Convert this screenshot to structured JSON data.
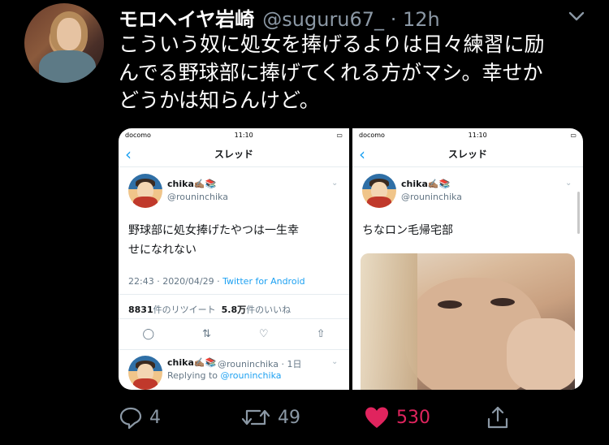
{
  "tweet": {
    "author_name": "モロヘイヤ岩崎",
    "author_meta": "@suguru67_ · 12h",
    "text_lines": [
      "こういう奴に処女を捧げるよりは日々練習に励",
      "んでる野球部に捧げてくれる方がマシ。幸せか",
      "どうかは知らんけど。"
    ],
    "actions": {
      "reply_count": "4",
      "retweet_count": "49",
      "like_count": "530"
    }
  },
  "media_left": {
    "carrier": "docomo",
    "time": "11:10",
    "nav_title": "スレッド",
    "main": {
      "name": "chika✍🏽📚",
      "handle": "@rouninchika",
      "body_lines": [
        "野球部に処女捧げたやつは一生幸",
        "せになれない"
      ],
      "timestamp": "22:43 · 2020/04/29 · ",
      "client": "Twitter for Android",
      "retweets_num": "8831",
      "retweets_label": "件のリツイート",
      "likes_num": "5.8万",
      "likes_label": "件のいいね"
    },
    "reply": {
      "name": "chika✍🏽📚",
      "handle": "@rouninchika · 1日",
      "replying_prefix": "Replying to ",
      "replying_to": "@rouninchika"
    }
  },
  "media_right": {
    "carrier": "docomo",
    "time": "11:10",
    "nav_title": "スレッド",
    "main": {
      "name": "chika✍🏽📚",
      "handle": "@rouninchika",
      "body": "ちなロン毛帰宅部"
    }
  },
  "colors": {
    "like_active": "#e0245e",
    "muted": "#8b98a5",
    "link": "#1da1f2"
  }
}
